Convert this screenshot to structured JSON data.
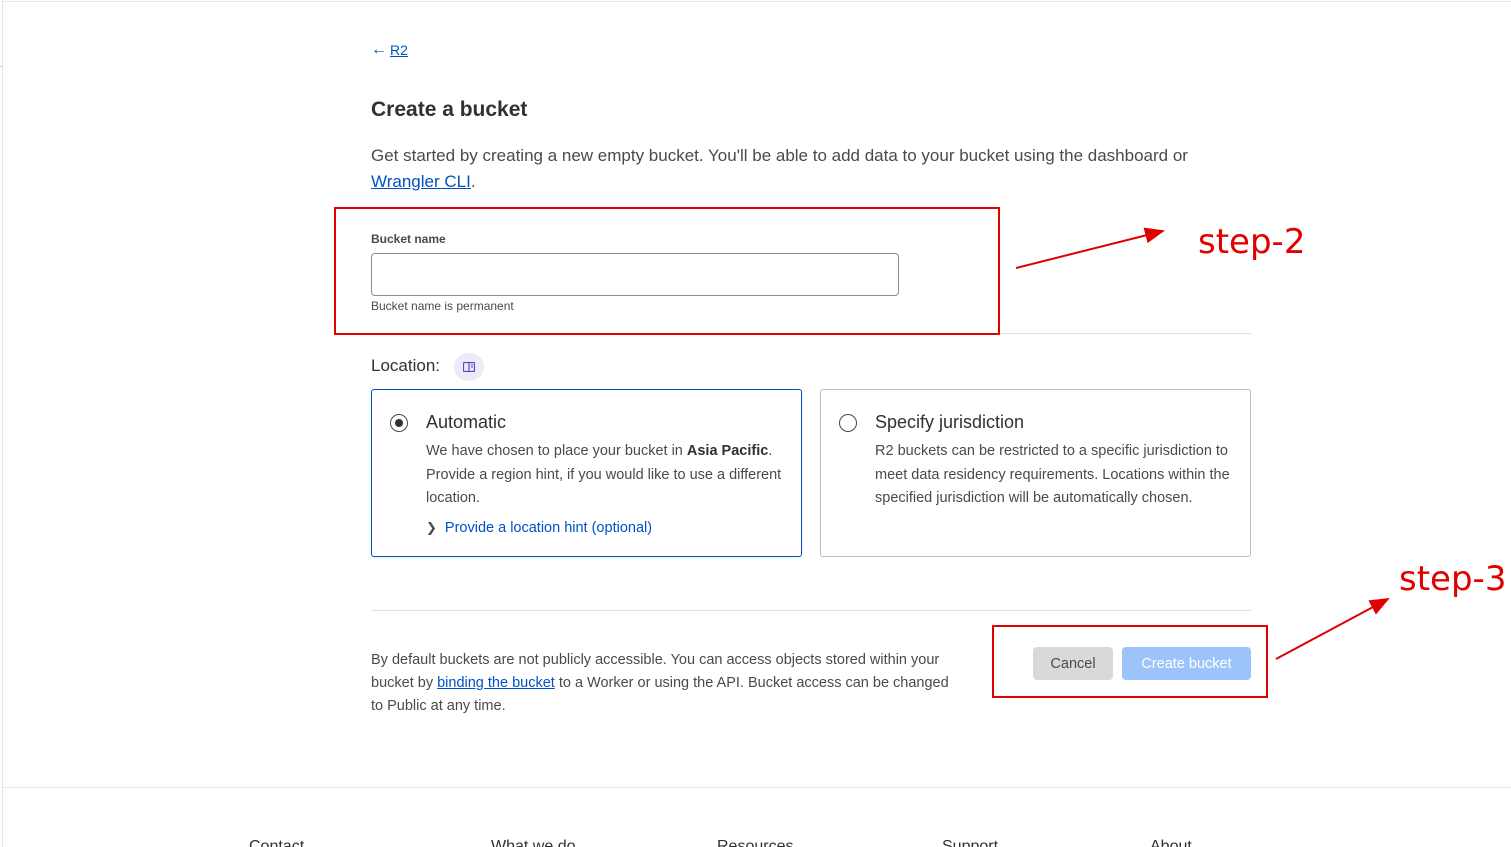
{
  "breadcrumb": {
    "back_label": "R2",
    "back_icon": "arrow-left-icon"
  },
  "page": {
    "title": "Create a bucket",
    "intro_text": "Get started by creating a new empty bucket. You'll be able to add data to your bucket using the dashboard or ",
    "intro_link": "Wrangler CLI",
    "intro_end": "."
  },
  "bucket_name": {
    "label": "Bucket name",
    "value": "",
    "help": "Bucket name is permanent"
  },
  "location": {
    "label": "Location:",
    "icon": "book-icon",
    "options": [
      {
        "title": "Automatic",
        "selected": true,
        "desc_prefix": "We have chosen to place your bucket in ",
        "desc_bold": "Asia Pacific",
        "desc_suffix": ". Provide a region hint, if you would like to use a different location.",
        "hint_label": "Provide a location hint (optional)"
      },
      {
        "title": "Specify jurisdiction",
        "selected": false,
        "desc": "R2 buckets can be restricted to a specific jurisdiction to meet data residency requirements. Locations within the specified jurisdiction will be automatically chosen."
      }
    ]
  },
  "access_note": {
    "prefix": "By default buckets are not publicly accessible. You can access objects stored within your bucket by ",
    "link": "binding the bucket",
    "suffix": " to a Worker or using the API. Bucket access can be changed to Public at any time."
  },
  "actions": {
    "cancel_label": "Cancel",
    "create_label": "Create bucket"
  },
  "annotations": {
    "step2": "step-2",
    "step3": "step-3",
    "color": "#e00000"
  },
  "footer": {
    "items": [
      "Contact",
      "What we do",
      "Resources",
      "Support",
      "About"
    ]
  }
}
